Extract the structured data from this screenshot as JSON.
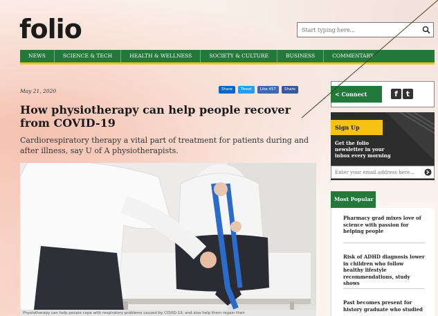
{
  "brand": {
    "logo_text": "folio",
    "accent_green": "#23783b",
    "accent_yellow": "#f5c214"
  },
  "search": {
    "placeholder": "Start typing here...",
    "icon": "search-icon"
  },
  "nav": {
    "items": [
      {
        "label": "NEWS"
      },
      {
        "label": "SCIENCE & TECH"
      },
      {
        "label": "HEALTH & WELLNESS"
      },
      {
        "label": "SOCIETY & CULTURE"
      },
      {
        "label": "BUSINESS"
      },
      {
        "label": "COMMENTARY"
      }
    ]
  },
  "article": {
    "date": "May 21, 2020",
    "share": {
      "linkedin": "Share",
      "twitter": "Tweet",
      "facebook_like": "Like 457",
      "facebook_share": "Share"
    },
    "headline": "How physiotherapy can help people recover from COVID-19",
    "deck": "Cardiorespiratory therapy a vital part of treatment for patients during and after illness, say U of A physiotherapists.",
    "image_alt": "Physiotherapist helping a seated patient stretch with a resistance band",
    "caption": "Physiotherapy can help people cope with respiratory problems caused by COVID-19, and also help them regain their"
  },
  "sidebar": {
    "connect": {
      "label": "Connect",
      "icon": "share-icon",
      "social": [
        "facebook-icon",
        "twitter-icon"
      ]
    },
    "signup": {
      "tag": "Sign Up",
      "text": "Get the folio newsletter in your inbox every morning",
      "placeholder": "Enter your email address here...",
      "go_icon": "arrow-right-circle-icon"
    },
    "popular": {
      "title": "Most Popular",
      "items": [
        {
          "title": "Pharmacy grad mixes love of science with passion for helping people"
        },
        {
          "title": "Risk of ADHD diagnosis lower in children who follow healthy lifestyle recommendations, study shows"
        },
        {
          "title": "Past becomes present for history graduate who studied"
        }
      ]
    }
  }
}
